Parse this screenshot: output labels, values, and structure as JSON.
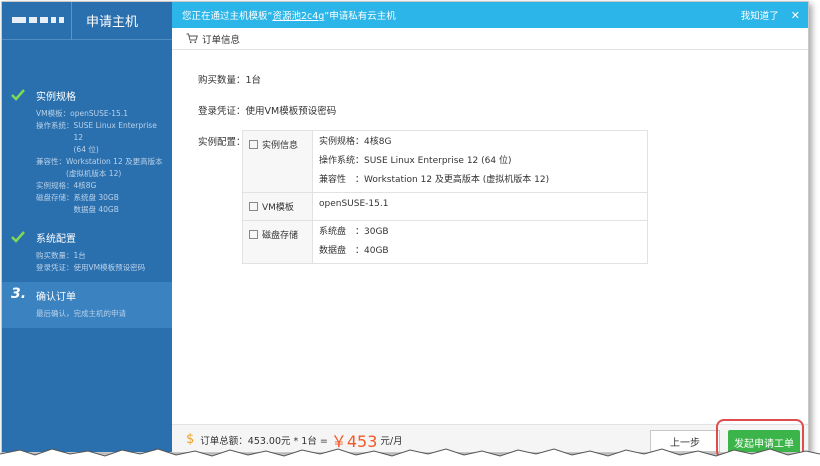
{
  "sidebar": {
    "title": "申请主机",
    "steps": [
      {
        "title": "实例规格",
        "details": [
          {
            "k": "VM模板：",
            "v": "openSUSE-15.1"
          },
          {
            "k": "操作系统：",
            "v": "SUSE Linux Enterprise 12\n(64 位)"
          },
          {
            "k": "兼容性：",
            "v": "Workstation 12 及更高版本\n(虚拟机版本 12)"
          },
          {
            "k": "实例规格：",
            "v": "4核8G"
          },
          {
            "k": "磁盘存储：",
            "v": "系统盘 30GB\n数据盘 40GB"
          }
        ]
      },
      {
        "title": "系统配置",
        "details": [
          {
            "k": "购买数量：",
            "v": "1台"
          },
          {
            "k": "登录凭证：",
            "v": "使用VM模板预设密码"
          }
        ]
      },
      {
        "number": "3.",
        "title": "确认订单",
        "hint": "最后确认，完成主机的申请"
      }
    ]
  },
  "topbar": {
    "prefix": "您正在通过主机模板“",
    "link": "资源池2c4g",
    "suffix": "”申请私有云主机",
    "got_it": "我知道了",
    "close": "✕"
  },
  "order": {
    "section_title": "订单信息",
    "quantity_label": "购买数量：",
    "quantity": "1台",
    "credential_label": "登录凭证：",
    "credential": "使用VM模板预设密码",
    "config_label": "实例配置：",
    "spec_rows": [
      {
        "label": "实例信息",
        "lines": [
          "实例规格：4核8G",
          "操作系统：SUSE Linux Enterprise 12 (64 位)",
          "兼容性　：Workstation 12 及更高版本 (虚拟机版本 12)"
        ]
      },
      {
        "label": "VM模板",
        "lines": [
          "openSUSE-15.1"
        ]
      },
      {
        "label": "磁盘存储",
        "lines": [
          "系统盘　：30GB",
          "数据盘　：40GB"
        ]
      }
    ]
  },
  "footer": {
    "total_label": "订单总额：453.00元 * 1台 =",
    "price": "￥453",
    "unit": "元/月",
    "prev_label": "上一步",
    "submit_label": "发起申请工单"
  },
  "colors": {
    "sidebar": "#2a6fae",
    "topbar": "#2cb5e8",
    "submit": "#3bb54a",
    "price": "#f05a28",
    "highlight": "#e04b4b"
  }
}
